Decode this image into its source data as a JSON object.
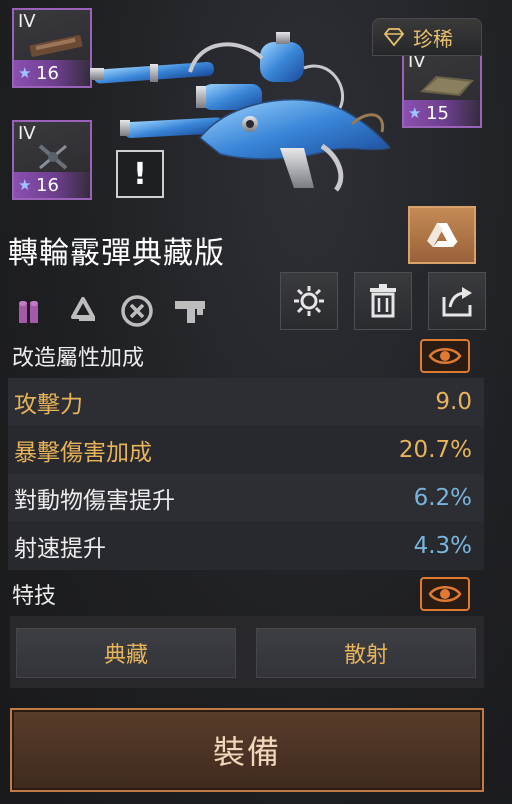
{
  "mods": [
    {
      "tier": "IV",
      "level": "16"
    },
    {
      "tier": "IV",
      "level": "15"
    },
    {
      "tier": "IV",
      "level": "16"
    }
  ],
  "rarity": {
    "label": "珍稀",
    "icon": "diamond-icon"
  },
  "weapon": {
    "name": "轉輪霰彈典藏版",
    "alert": "!"
  },
  "sections": {
    "mod_bonus": "改造屬性加成",
    "skills": "特技"
  },
  "stats": [
    {
      "label": "攻擊力",
      "value": "9.0"
    },
    {
      "label": "暴擊傷害加成",
      "value": "20.7%"
    },
    {
      "label": "對動物傷害提升",
      "value": "6.2%"
    },
    {
      "label": "射速提升",
      "value": "4.3%"
    }
  ],
  "skills": [
    "典藏",
    "散射"
  ],
  "equip_label": "裝備",
  "colors": {
    "gold": "#e8b45a",
    "blue": "#78b4dc",
    "accent_orange": "#e07a30",
    "rarity_purple": "#9a62b8"
  }
}
